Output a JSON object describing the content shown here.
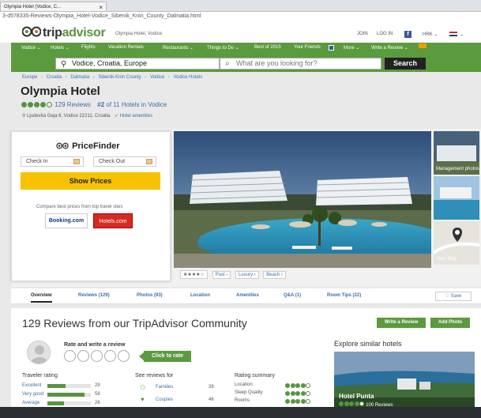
{
  "browser": {
    "tab_title": "Olympia Hotel (Vodice, C...",
    "url": "3-d578335-Reviews-Olympia_Hotel-Vodice_Sibenik_Knin_County_Dalmatia.html"
  },
  "header": {
    "logo_trip": "trip",
    "logo_advisor": "advisor",
    "page_hint": "Olympia Hotel, Vodice",
    "join": "JOIN",
    "login": "LOG IN",
    "currency": "HRK ⌄",
    "flag_menu": "⌄"
  },
  "nav": {
    "items": [
      "Vodice ⌄",
      "Hotels ⌄",
      "Flights",
      "Vacation Rentals",
      "Restaurants ⌄",
      "Things to Do ⌄",
      "Best of 2015",
      "Your Friends",
      "More ⌄",
      "Write a Review ⌄"
    ]
  },
  "search": {
    "location": "Vodice, Croatia, Europe",
    "query_placeholder": "What are you looking for?",
    "button": "Search"
  },
  "breadcrumb": [
    "Europe",
    "›",
    "Croatia",
    "›",
    "Dalmatia",
    "›",
    "Sibenik-Knin County",
    "›",
    "Vodice",
    "›",
    "Vodice Hotels"
  ],
  "hotel": {
    "name": "Olympia Hotel",
    "rating_bubbles": 4,
    "reviews_link": "129 Reviews",
    "rank": "#2",
    "rank_rest": "of 11 Hotels in Vodice",
    "address": "Ljudevita Gaja 6, Vodice 22211, Croatia",
    "amenities_link": "Hotel amenities"
  },
  "pricefinder": {
    "title_owl": "PriceFinder",
    "check_in": "Check In",
    "check_out": "Check Out",
    "button": "Show Prices",
    "note": "Compare best prices from top travel sites",
    "booking": "Booking.com",
    "hotels": "Hotels.com"
  },
  "photos": {
    "thumb1_label": "Management photos",
    "thumb3_label": "View Map"
  },
  "tags": {
    "stars": "★★★★☆",
    "pool": "Pool ›",
    "luxury": "Luxury ›",
    "beach": "Beach ›"
  },
  "tabs": [
    "Overview",
    "Reviews (129)",
    "Photos (93)",
    "Location",
    "Amenities",
    "Q&A (1)",
    "Room Tips (22)"
  ],
  "save": "♡ Save",
  "reviews": {
    "title": "129 Reviews from our TripAdvisor Community",
    "write_review": "Write a Review",
    "add_photo": "Add Photo",
    "rate_label": "Rate and write a review",
    "click_to_rate": "Click to rate",
    "traveler_rating": "Traveler rating",
    "see_reviews_for": "See reviews for",
    "rating_summary": "Rating summary",
    "rating_rows": [
      {
        "label": "Excellent",
        "count": "29",
        "frac": 0.42
      },
      {
        "label": "Very good",
        "count": "58",
        "frac": 0.85
      },
      {
        "label": "Average",
        "count": "26",
        "frac": 0.38
      }
    ],
    "see_rows": [
      {
        "label": "Families",
        "count": "39"
      },
      {
        "label": "Couples",
        "count": "46"
      }
    ],
    "summary_rows": [
      {
        "label": "Location",
        "bubbles": 4
      },
      {
        "label": "Sleep Quality",
        "bubbles": 4
      },
      {
        "label": "Rooms",
        "bubbles": 4
      }
    ]
  },
  "similar": {
    "title": "Explore similar hotels",
    "hotel_name": "Hotel Punta",
    "reviews": "100 Reviews"
  },
  "colors": {
    "green": "#5b9a3e",
    "yellow": "#f7c200",
    "link": "#3b6ea5"
  }
}
